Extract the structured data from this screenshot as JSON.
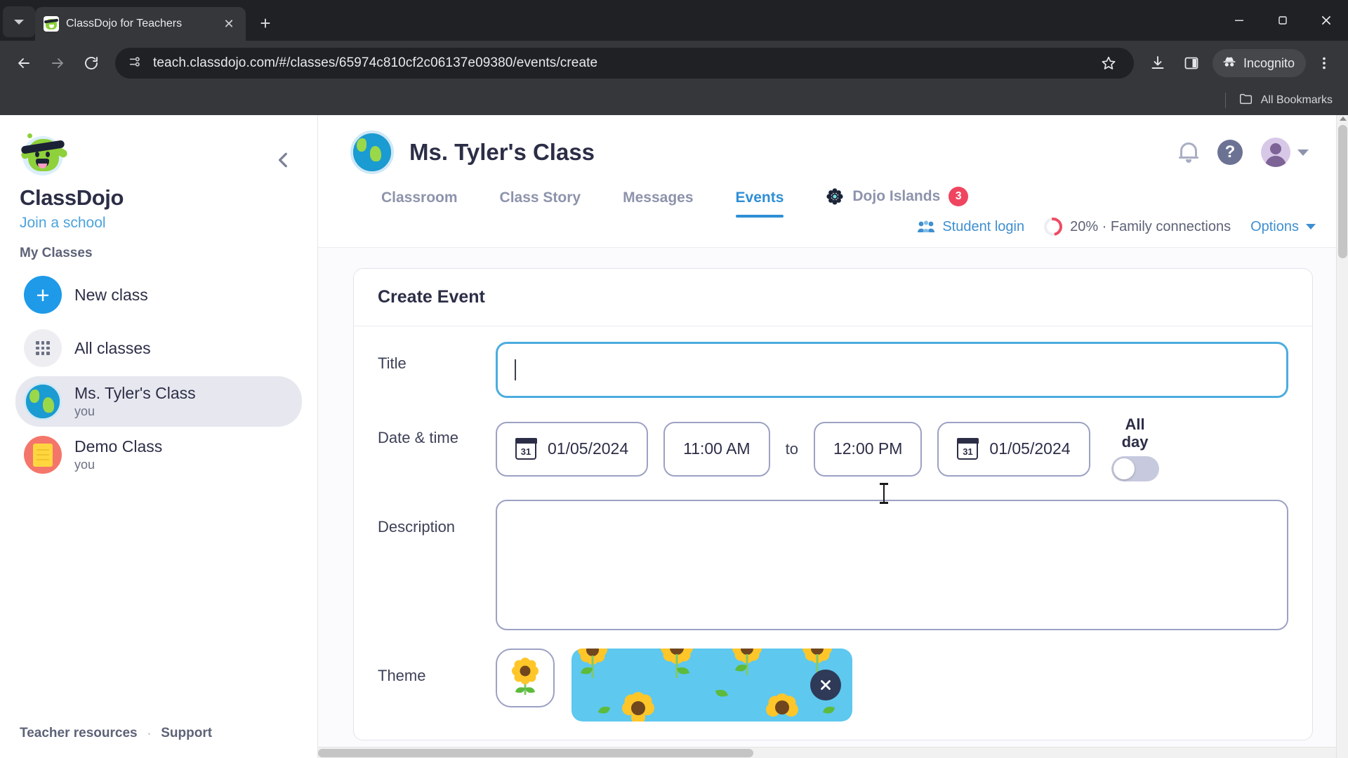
{
  "browser": {
    "tab": {
      "title": "ClassDojo for Teachers",
      "favicon": "classdojo-favicon",
      "close_label": "✕"
    },
    "new_tab_label": "+",
    "tab_search_icon": "chevron-down-icon",
    "nav": {
      "back": "←",
      "forward": "→",
      "reload": "↻"
    },
    "omnibox": {
      "url": "teach.classdojo.com/#/classes/65974c810cf2c06137e09380/events/create",
      "site_info_icon": "page-info-icon"
    },
    "toolbar": {
      "bookmark_icon": "star-icon",
      "download_icon": "download-icon",
      "side_panel_icon": "side-panel-icon",
      "incognito_label": "Incognito",
      "incognito_icon": "incognito-hat-icon",
      "menu_icon": "three-dot-menu-icon"
    },
    "window": {
      "minimize": "–",
      "maximize": "❐",
      "close": "✕"
    },
    "bookmarks_bar": {
      "label": "All Bookmarks",
      "icon": "folder-icon"
    }
  },
  "sidebar": {
    "brand": "ClassDojo",
    "join_school": "Join a school",
    "section_label": "My Classes",
    "collapse_icon": "chevron-left-icon",
    "items": [
      {
        "name": "New class",
        "sub": "",
        "icon": "plus-icon",
        "selected": false
      },
      {
        "name": "All classes",
        "sub": "",
        "icon": "grid-icon",
        "selected": false
      },
      {
        "name": "Ms. Tyler's Class",
        "sub": "you",
        "icon": "globe-icon",
        "selected": true
      },
      {
        "name": "Demo Class",
        "sub": "you",
        "icon": "notebook-icon",
        "selected": false
      }
    ],
    "footer": {
      "resources": "Teacher resources",
      "separator": "·",
      "support": "Support"
    }
  },
  "header": {
    "class_title": "Ms. Tyler's Class",
    "class_avatar_icon": "globe-icon",
    "bell_icon": "notification-bell-icon",
    "help_label": "?",
    "avatar_icon": "user-avatar-icon",
    "avatar_caret": "chevron-down-icon",
    "tabs": [
      {
        "label": "Classroom",
        "active": false
      },
      {
        "label": "Class Story",
        "active": false
      },
      {
        "label": "Messages",
        "active": false
      },
      {
        "label": "Events",
        "active": true
      },
      {
        "label": "Dojo Islands",
        "active": false,
        "badge": "3",
        "icon": "dojo-islands-icon"
      }
    ],
    "sub_bar": {
      "student_login": "Student login",
      "student_login_icon": "students-icon",
      "family_connections": "20% · Family connections",
      "family_progress_icon": "progress-ring-icon",
      "family_percent": "20%",
      "options": "Options",
      "options_caret": "chevron-down-icon"
    }
  },
  "card": {
    "title": "Create Event",
    "fields": {
      "title": {
        "label": "Title",
        "value": "",
        "placeholder": "",
        "focused": true
      },
      "datetime": {
        "label": "Date & time",
        "start_date": "01/05/2024",
        "start_time": "11:00 AM",
        "separator": "to",
        "end_time": "12:00 PM",
        "end_date": "01/05/2024",
        "calendar_icon": "calendar-icon",
        "calendar_day": "31",
        "all_day_label_line1": "All",
        "all_day_label_line2": "day",
        "all_day_on": false
      },
      "description": {
        "label": "Description",
        "value": "",
        "placeholder": ""
      },
      "theme": {
        "label": "Theme",
        "picker_icon": "sunflower-icon",
        "selected_theme": "sunflowers",
        "remove_icon": "close-x-icon"
      }
    }
  },
  "colors": {
    "accent_blue": "#2e8fd6",
    "link_blue": "#3f8fd0",
    "focus_blue": "#4cacdf",
    "badge_red": "#f0455f",
    "ink": "#2c2e47",
    "muted": "#8d93ab",
    "border": "#9ca1c4",
    "theme_sky": "#5ec8ef"
  }
}
